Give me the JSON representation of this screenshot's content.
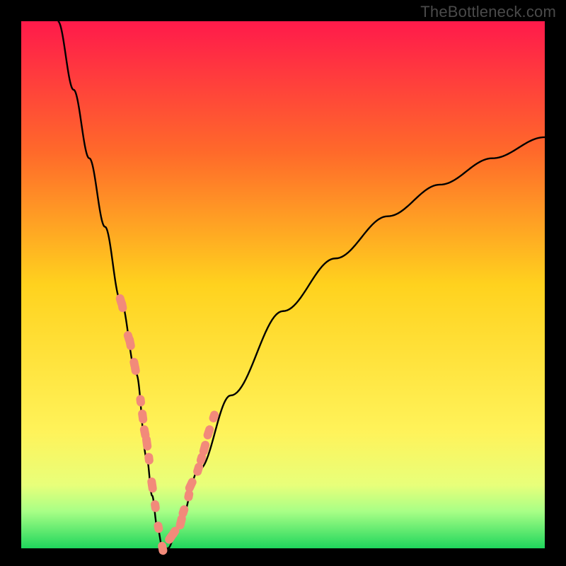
{
  "watermark": "TheBottleneck.com",
  "chart_data": {
    "type": "line",
    "title": "",
    "xlabel": "",
    "ylabel": "",
    "x_range": [
      0,
      100
    ],
    "y_range": [
      0,
      100
    ],
    "grid": false,
    "legend": null,
    "gradient_stops": [
      {
        "offset": 0.0,
        "color": "#ff1a4b"
      },
      {
        "offset": 0.25,
        "color": "#ff6a2a"
      },
      {
        "offset": 0.5,
        "color": "#ffd21e"
      },
      {
        "offset": 0.78,
        "color": "#fff35a"
      },
      {
        "offset": 0.88,
        "color": "#e8ff7a"
      },
      {
        "offset": 0.93,
        "color": "#a8ff86"
      },
      {
        "offset": 1.0,
        "color": "#1fd65c"
      }
    ],
    "series": [
      {
        "name": "bottleneck-curve",
        "x": [
          7,
          10,
          13,
          16,
          19,
          22,
          24,
          25,
          26,
          27,
          28,
          30,
          34,
          40,
          50,
          60,
          70,
          80,
          90,
          100
        ],
        "y": [
          100,
          87,
          74,
          61,
          47,
          33,
          17,
          10,
          4,
          0,
          0,
          4,
          15,
          29,
          45,
          55,
          63,
          69,
          74,
          78
        ],
        "color": "#000000"
      }
    ],
    "marker_clusters": [
      {
        "name": "left-arm-markers",
        "x": [
          19.0,
          19.3,
          20.5,
          20.8,
          21.6,
          21.8,
          22.8,
          23.2,
          23.6,
          24.0,
          24.4,
          25.0,
          25.6,
          26.2,
          27.0
        ],
        "y": [
          47,
          46,
          40,
          39,
          35,
          34,
          28,
          25,
          22,
          20,
          17,
          12,
          8,
          4,
          0
        ],
        "color": "#f28a7a"
      },
      {
        "name": "right-arm-markers",
        "x": [
          28.5,
          29.2,
          30.5,
          31.0,
          32.0,
          32.4,
          33.8,
          34.4,
          35.0,
          35.8,
          36.8
        ],
        "y": [
          2,
          3,
          5,
          7,
          10,
          12,
          15,
          17,
          19,
          22,
          25
        ],
        "color": "#f28a7a"
      }
    ]
  }
}
